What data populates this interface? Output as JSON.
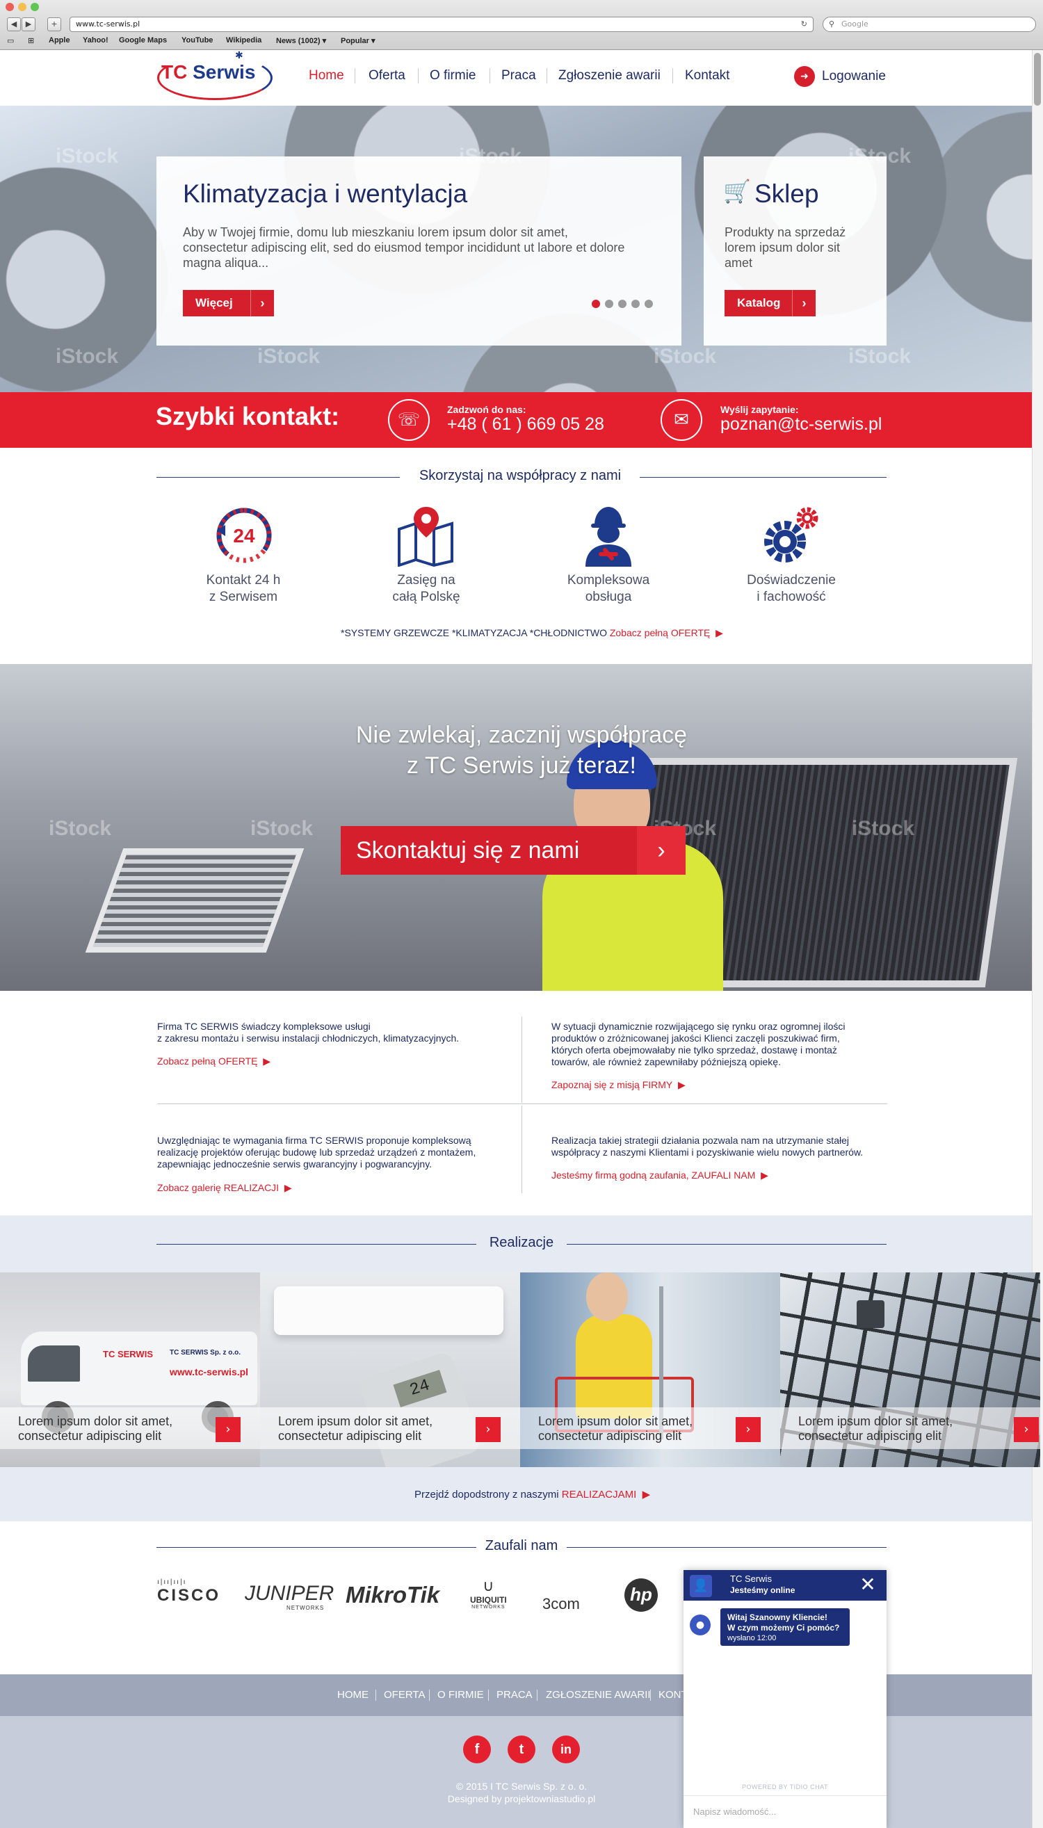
{
  "browser": {
    "url": "www.tc-serwis.pl",
    "search_placeholder": "Google",
    "bookmarks": [
      "Apple",
      "Yahoo!",
      "Google Maps",
      "YouTube",
      "Wikipedia",
      "News (1002) ▾",
      "Popular ▾"
    ]
  },
  "header": {
    "logo_tc": "TC",
    "logo_serwis": "Serwis",
    "menu": [
      "Home",
      "Oferta",
      "O firmie",
      "Praca",
      "Zgłoszenie awarii",
      "Kontakt"
    ],
    "login": "Logowanie"
  },
  "hero": {
    "title": "Klimatyzacja i wentylacja",
    "text": "Aby w Twojej firmie, domu lub mieszkaniu lorem ipsum dolor sit amet, consectetur adipiscing elit, sed do eiusmod tempor incididunt ut labore et dolore magna aliqua...",
    "button": "Więcej",
    "shop_title": "Sklep",
    "shop_text": "Produkty na sprzedaż lorem ipsum dolor sit amet",
    "shop_button": "Katalog",
    "watermark": "iStock"
  },
  "quick_contact": {
    "title": "Szybki kontakt:",
    "phone_label": "Zadzwoń do nas:",
    "phone": "+48 ( 61 ) 669 05 28",
    "email_label": "Wyślij zapytanie:",
    "email": "poznan@tc-serwis.pl"
  },
  "cooperation": {
    "title": "Skorzystaj na współpracy z nami",
    "features": [
      {
        "line1": "Kontakt 24 h",
        "line2": "z Serwisem",
        "badge": "24"
      },
      {
        "line1": "Zasięg na",
        "line2": "całą Polskę"
      },
      {
        "line1": "Kompleksowa",
        "line2": "obsługa"
      },
      {
        "line1": "Doświadczenie",
        "line2": "i fachowość"
      }
    ],
    "systems": "*SYSTEMY GRZEWCZE *KLIMATYZACJA *CHŁODNICTWO",
    "systems_link": "Zobacz pełną OFERTĘ"
  },
  "cta": {
    "title_line1": "Nie zwlekaj, zacznij współpracę",
    "title_line2": "z TC Serwis już teraz!",
    "button": "Skontaktuj się z nami"
  },
  "info": [
    {
      "text1": "Firma TC SERWIS świadczy kompleksowe usługi",
      "text2": "z zakresu montażu i serwisu instalacji chłodniczych, klimatyzacyjnych.",
      "link": "Zobacz pełną OFERTĘ"
    },
    {
      "text1": "W sytuacji dynamicznie rozwijającego się rynku oraz ogromnej ilości",
      "text2": "produktów o zróżnicowanej jakości Klienci zaczęli poszukiwać firm,",
      "text3": "których oferta obejmowałaby nie tylko sprzedaż, dostawę i montaż",
      "text4": "towarów, ale również zapewniłaby późniejszą opiekę.",
      "link": "Zapoznaj się z misją FIRMY"
    },
    {
      "text1": "Uwzględniając te wymagania firma TC SERWIS proponuje kompleksową",
      "text2": "realizację projektów oferując budowę lub sprzedaż urządzeń z montażem,",
      "text3": "zapewniając jednocześnie serwis gwarancyjny i pogwarancyjny.",
      "link": "Zobacz galerię REALIZACJI"
    },
    {
      "text1": "Realizacja takiej strategii działania pozwala nam na utrzymanie stałej",
      "text2": "współpracy z naszymi Klientami i pozyskiwanie wielu nowych partnerów.",
      "link": "Jesteśmy firmą godną zaufania, ZAUFALI NAM"
    }
  ],
  "realizacje": {
    "title": "Realizacje",
    "tiles": [
      {
        "line1": "Lorem ipsum dolor sit amet,",
        "line2": "consectetur adipiscing elit",
        "van_brand": "TC SERWIS",
        "van_company": "TC SERWIS Sp. z o.o.",
        "van_url": "www.tc-serwis.pl"
      },
      {
        "line1": "Lorem ipsum dolor sit amet,",
        "line2": "consectetur adipiscing elit",
        "display": "24"
      },
      {
        "line1": "Lorem ipsum dolor sit amet,",
        "line2": "consectetur adipiscing elit"
      },
      {
        "line1": "Lorem ipsum dolor sit amet,",
        "line2": "consectetur adipiscing elit"
      }
    ],
    "link_prefix": "Przejdź dopodstrony z naszymi",
    "link_highlight": "REALIZACJAMI"
  },
  "trusted": {
    "title": "Zaufali nam",
    "brands": [
      "CISCO",
      "JUNIPER",
      "MikroTik",
      "UBIQUITI",
      "3com",
      "hp"
    ],
    "brand_sub": {
      "juniper": "NETWORKS",
      "ubiquiti": "NETWORKS"
    }
  },
  "footer": {
    "nav": [
      "HOME",
      "OFERTA",
      "O FIRMIE",
      "PRACA",
      "ZGŁOSZENIE AWARII",
      "KONT"
    ],
    "social": [
      "f",
      "t",
      "in"
    ],
    "copyright": "© 2015   I   TC Serwis Sp. z o. o.",
    "designed": "Designed by projektowniastudio.pl"
  },
  "chat": {
    "name": "TC Serwis",
    "status": "Jesteśmy online",
    "message_line1": "Witaj Szanowny Kliencie!",
    "message_line2": "W czym możemy Ci pomóc?",
    "sent": "wysłano 12:00",
    "powered": "POWERED BY TIDIO CHAT",
    "placeholder": "Napisz wiadomość..."
  },
  "colors": {
    "brand_red": "#d61f2c",
    "brand_navy": "#1e2b63",
    "quick_bar": "#e41f2e",
    "chat_header": "#1e2f7a"
  }
}
